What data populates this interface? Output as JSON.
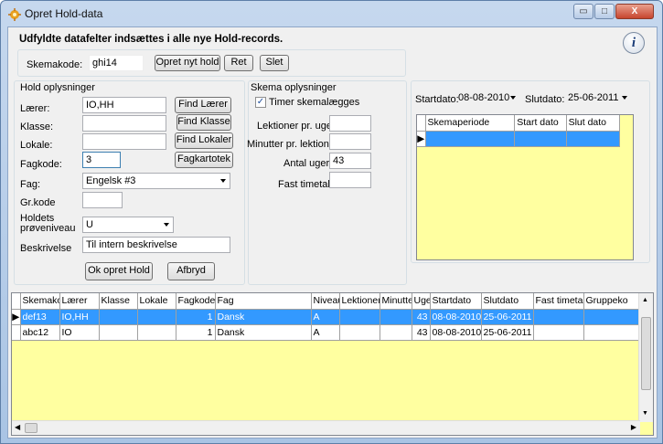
{
  "window": {
    "title": "Opret Hold-data",
    "minimize": "▭",
    "maximize": "□",
    "close": "X"
  },
  "header": "Udfyldte datafelter indsættes i alle nye Hold-records.",
  "toolbar": {
    "skemakode_label": "Skemakode:",
    "skemakode_value": "ghi14",
    "opret_btn": "Opret nyt hold",
    "ret_btn": "Ret",
    "slet_btn": "Slet"
  },
  "hold": {
    "title": "Hold oplysninger",
    "laerer_label": "Lærer:",
    "laerer_value": "IO,HH",
    "find_laerer": "Find Lærer",
    "klasse_label": "Klasse:",
    "klasse_value": "",
    "find_klasse": "Find Klasse",
    "lokale_label": "Lokale:",
    "lokale_value": "",
    "find_lokaler": "Find Lokaler",
    "fagkode_label": "Fagkode:",
    "fagkode_value": "3",
    "fagkartotek": "Fagkartotek",
    "fag_label": "Fag:",
    "fag_value": "Engelsk #3",
    "grkode_label": "Gr.kode",
    "grkode_value": "",
    "niveau_label1": "Holdets",
    "niveau_label2": "prøveniveau",
    "niveau_value": "U",
    "beskrivelse_label": "Beskrivelse",
    "beskrivelse_value": "Til intern beskrivelse",
    "ok_btn": "Ok opret Hold",
    "afbryd_btn": "Afbryd"
  },
  "skema": {
    "title": "Skema oplysninger",
    "timer_label": "Timer skemalægges",
    "timer_checked": "✓",
    "lektioner_label": "Lektioner pr. uge:",
    "lektioner_value": "",
    "minutter_label": "Minutter pr. lektion:",
    "minutter_value": "",
    "antal_label": "Antal uger:",
    "antal_value": "43",
    "fast_label": "Fast timetal:",
    "fast_value": ""
  },
  "dates": {
    "start_label": "Startdato:",
    "start_value": "08-08-2010",
    "slut_label": "Slutdato:",
    "slut_value": "25-06-2011"
  },
  "periode_grid": {
    "columns": [
      "Skemaperiode",
      "Start dato",
      "Slut dato"
    ]
  },
  "main_grid": {
    "columns": [
      "Skemakode",
      "Lærer",
      "Klasse",
      "Lokale",
      "Fagkode",
      "Fag",
      "Niveau",
      "Lektioner",
      "Minutter",
      "Uger",
      "Startdato",
      "Slutdato",
      "Fast timetal",
      "Gruppeko"
    ],
    "rows": [
      [
        "def13",
        "IO,HH",
        "",
        "",
        "1",
        "Dansk",
        "A",
        "",
        "",
        "43",
        "08-08-2010",
        "25-06-2011",
        "",
        ""
      ],
      [
        "abc12",
        "IO",
        "",
        "",
        "1",
        "Dansk",
        "A",
        "",
        "",
        "43",
        "08-08-2010",
        "25-06-2011",
        "",
        ""
      ]
    ]
  },
  "icons": {
    "app": "app-icon",
    "info": "info-icon"
  }
}
